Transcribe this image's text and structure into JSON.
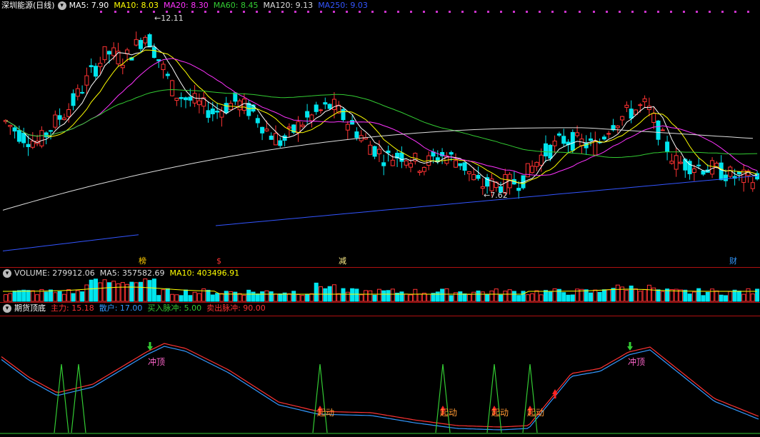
{
  "main_legend": {
    "title": "深圳能源(日线)",
    "items": [
      {
        "label": "MA5: 7.90",
        "color": "#ffffff"
      },
      {
        "label": "MA10: 8.03",
        "color": "#ffff00"
      },
      {
        "label": "MA20: 8.30",
        "color": "#ff33ff"
      },
      {
        "label": "MA60: 8.45",
        "color": "#33cc33"
      },
      {
        "label": "MA120: 9.13",
        "color": "#dddddd"
      },
      {
        "label": "MA250: 9.03",
        "color": "#3355ff"
      }
    ]
  },
  "price_marks": {
    "high": "12.11",
    "low": "7.62"
  },
  "event_tags": [
    {
      "text": "榜",
      "color": "#ffcc00"
    },
    {
      "text": "$",
      "color": "#ff3333"
    },
    {
      "text": "减",
      "color": "#ffee88"
    },
    {
      "text": "财",
      "color": "#3399ff"
    }
  ],
  "volume_legend": {
    "items": [
      {
        "label": "VOLUME: 279912.06",
        "color": "#dddddd"
      },
      {
        "label": "MA5: 357582.69",
        "color": "#dddddd"
      },
      {
        "label": "MA10: 403496.91",
        "color": "#ffff00"
      }
    ]
  },
  "indicator_legend": {
    "title": "期货顶底",
    "items": [
      {
        "label": "主力: 15.18",
        "color": "#ff3333"
      },
      {
        "label": "散户: 17.00",
        "color": "#3399ff"
      },
      {
        "label": "买入脉冲: 5.00",
        "color": "#33cc33"
      },
      {
        "label": "卖出脉冲: 90.00",
        "color": "#ff3333"
      }
    ]
  },
  "signals": {
    "top_label": "冲顶",
    "start_label": "起动"
  },
  "colors": {
    "up": "#ff3333",
    "down": "#00e5ee",
    "ma5": "#ffffff",
    "ma10": "#ffff00",
    "ma20": "#ff33ff",
    "ma60": "#33cc33",
    "ma120": "#dddddd",
    "ma250": "#3355ff"
  }
}
